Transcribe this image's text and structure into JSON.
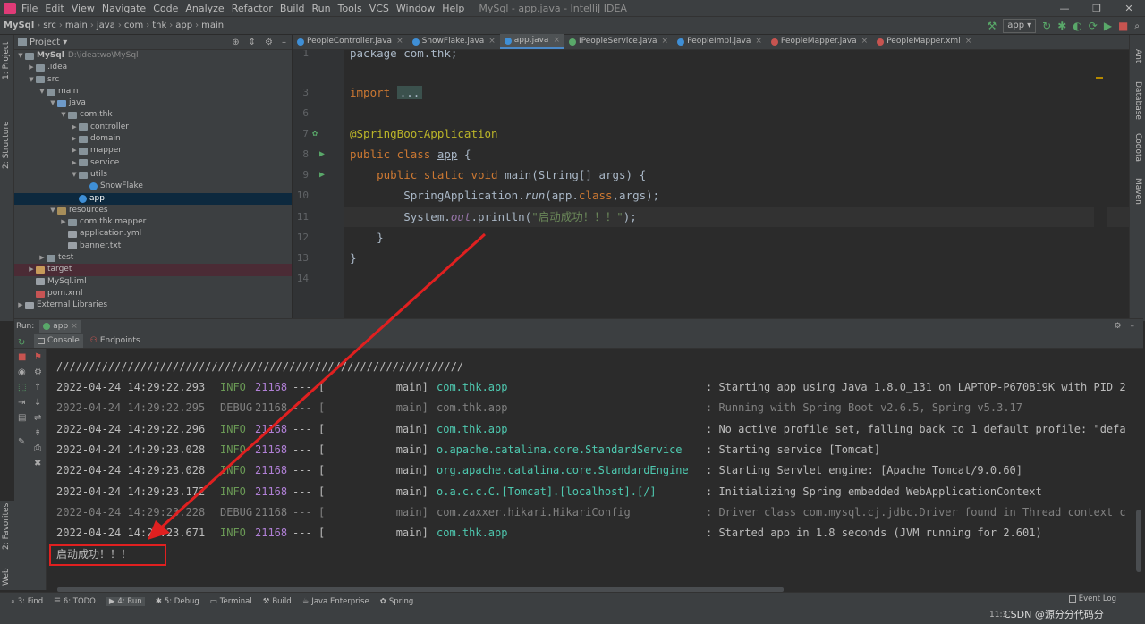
{
  "menubar": {
    "items": [
      "File",
      "Edit",
      "View",
      "Navigate",
      "Code",
      "Analyze",
      "Refactor",
      "Build",
      "Run",
      "Tools",
      "VCS",
      "Window",
      "Help"
    ],
    "window_title": "MySql - app.java - IntelliJ IDEA",
    "min": "—",
    "max": "❐",
    "close": "✕"
  },
  "navbar": {
    "crumbs": [
      "MySql",
      "src",
      "main",
      "java",
      "com",
      "thk",
      "app",
      "main"
    ],
    "run_config": "app"
  },
  "project": {
    "header": "Project",
    "tree": [
      {
        "label": "MySql",
        "extra": "D:\\ideatwo\\MySql",
        "level": 0,
        "arrow": "▼",
        "icon": "folder",
        "bold": true
      },
      {
        "label": ".idea",
        "level": 1,
        "arrow": "▶",
        "icon": "folder"
      },
      {
        "label": "src",
        "level": 1,
        "arrow": "▼",
        "icon": "folder"
      },
      {
        "label": "main",
        "level": 2,
        "arrow": "▼",
        "icon": "folder"
      },
      {
        "label": "java",
        "level": 3,
        "arrow": "▼",
        "icon": "srcf"
      },
      {
        "label": "com.thk",
        "level": 4,
        "arrow": "▼",
        "icon": "pkgf"
      },
      {
        "label": "controller",
        "level": 5,
        "arrow": "▶",
        "icon": "pkgf"
      },
      {
        "label": "domain",
        "level": 5,
        "arrow": "▶",
        "icon": "pkgf"
      },
      {
        "label": "mapper",
        "level": 5,
        "arrow": "▶",
        "icon": "pkgf"
      },
      {
        "label": "service",
        "level": 5,
        "arrow": "▶",
        "icon": "pkgf"
      },
      {
        "label": "utils",
        "level": 5,
        "arrow": "▼",
        "icon": "pkgf"
      },
      {
        "label": "SnowFlake",
        "level": 6,
        "arrow": "",
        "icon": "cls"
      },
      {
        "label": "app",
        "level": 5,
        "arrow": "",
        "icon": "cls",
        "selected": true
      },
      {
        "label": "resources",
        "level": 3,
        "arrow": "▼",
        "icon": "resf"
      },
      {
        "label": "com.thk.mapper",
        "level": 4,
        "arrow": "▶",
        "icon": "folder"
      },
      {
        "label": "application.yml",
        "level": 4,
        "arrow": "",
        "icon": "txtf"
      },
      {
        "label": "banner.txt",
        "level": 4,
        "arrow": "",
        "icon": "txtf"
      },
      {
        "label": "test",
        "level": 2,
        "arrow": "▶",
        "icon": "folder"
      },
      {
        "label": "target",
        "level": 1,
        "arrow": "▶",
        "icon": "orgf",
        "target": true
      },
      {
        "label": "MySql.iml",
        "level": 1,
        "arrow": "",
        "icon": "imlf"
      },
      {
        "label": "pom.xml",
        "level": 1,
        "arrow": "",
        "icon": "mvn"
      },
      {
        "label": "External Libraries",
        "level": 0,
        "arrow": "▶",
        "icon": "libf"
      }
    ]
  },
  "tabs": [
    {
      "label": "PeopleController.java",
      "color": "#3f8fd6"
    },
    {
      "label": "SnowFlake.java",
      "color": "#3f8fd6"
    },
    {
      "label": "app.java",
      "color": "#3f8fd6",
      "active": true
    },
    {
      "label": "IPeopleService.java",
      "color": "#59a869"
    },
    {
      "label": "PeopleImpl.java",
      "color": "#3f8fd6"
    },
    {
      "label": "PeopleMapper.java",
      "color": "#c75450"
    },
    {
      "label": "PeopleMapper.xml",
      "color": "#c75450"
    }
  ],
  "editor": {
    "line_numbers": [
      "1",
      "3",
      "6",
      "7",
      "8",
      "9",
      "10",
      "11",
      "12",
      "13",
      "14"
    ],
    "lines": {
      "l1": "package com.thk;",
      "l3_kw": "import ",
      "l3_fold": "...",
      "l7": "@SpringBootApplication",
      "l8_kw": "public class ",
      "l8_name": "app",
      "l8_brace": " {",
      "l9_kw": "    public static void ",
      "l9_rest": "main(String[] args) {",
      "l10_a": "        SpringApplication.",
      "l10_run": "run",
      "l10_b": "(app.",
      "l10_cls": "class",
      "l10_c": ",args);",
      "l11_a": "        System.",
      "l11_out": "out",
      "l11_b": ".println(",
      "l11_str": "\"启动成功！！！\"",
      "l11_c": ");",
      "l12": "    }",
      "l13": "}"
    }
  },
  "run": {
    "label": "Run:",
    "tab": "app",
    "sub_console": "Console",
    "sub_endpoints": "Endpoints"
  },
  "console": {
    "banner_line": "///////////////////////////////////////////////////////////////",
    "logs": [
      {
        "ts": "2022-04-24 14:29:22.293",
        "level": "INFO",
        "pid": "21168",
        "sep": "---",
        "thread": "[           main]",
        "logger": "com.thk.app",
        "msg": ": Starting app using Java 1.8.0_131 on LAPTOP-P670B19K with PID 2",
        "dim": false
      },
      {
        "ts": "2022-04-24 14:29:22.295",
        "level": "DEBUG",
        "pid": "21168",
        "sep": "---",
        "thread": "[           main]",
        "logger": "com.thk.app",
        "msg": ": Running with Spring Boot v2.6.5, Spring v5.3.17",
        "dim": true
      },
      {
        "ts": "2022-04-24 14:29:22.296",
        "level": "INFO",
        "pid": "21168",
        "sep": "---",
        "thread": "[           main]",
        "logger": "com.thk.app",
        "msg": ": No active profile set, falling back to 1 default profile: \"defa",
        "dim": false
      },
      {
        "ts": "2022-04-24 14:29:23.028",
        "level": "INFO",
        "pid": "21168",
        "sep": "---",
        "thread": "[           main]",
        "logger": "o.apache.catalina.core.StandardService",
        "msg": ": Starting service [Tomcat]",
        "dim": false
      },
      {
        "ts": "2022-04-24 14:29:23.028",
        "level": "INFO",
        "pid": "21168",
        "sep": "---",
        "thread": "[           main]",
        "logger": "org.apache.catalina.core.StandardEngine",
        "msg": ": Starting Servlet engine: [Apache Tomcat/9.0.60]",
        "dim": false
      },
      {
        "ts": "2022-04-24 14:29:23.172",
        "level": "INFO",
        "pid": "21168",
        "sep": "---",
        "thread": "[           main]",
        "logger": "o.a.c.c.C.[Tomcat].[localhost].[/]",
        "msg": ": Initializing Spring embedded WebApplicationContext",
        "dim": false
      },
      {
        "ts": "2022-04-24 14:29:23.228",
        "level": "DEBUG",
        "pid": "21168",
        "sep": "---",
        "thread": "[           main]",
        "logger": "com.zaxxer.hikari.HikariConfig",
        "msg": ": Driver class com.mysql.cj.jdbc.Driver found in Thread context c",
        "dim": true
      },
      {
        "ts": "2022-04-24 14:29:23.671",
        "level": "INFO",
        "pid": "21168",
        "sep": "---",
        "thread": "[           main]",
        "logger": "com.thk.app",
        "msg": ": Started app in 1.8 seconds (JVM running for 2.601)",
        "dim": false
      }
    ],
    "output": "启动成功！！！"
  },
  "bottombar": {
    "items": [
      "3: Find",
      "6: TODO",
      "4: Run",
      "5: Debug",
      "Terminal",
      "Build",
      "Java Enterprise",
      "Spring"
    ],
    "event_log": "Event Log"
  },
  "statusbar": {
    "time": "11:3",
    "watermark": "CSDN @源分分代码分"
  },
  "side": {
    "left_top": "1: Project",
    "left_structure": "2: Structure",
    "left_favorites": "2: Favorites",
    "left_web": "Web",
    "right_ant": "Ant",
    "right_db": "Database",
    "right_codota": "Codota",
    "right_maven": "Maven"
  }
}
